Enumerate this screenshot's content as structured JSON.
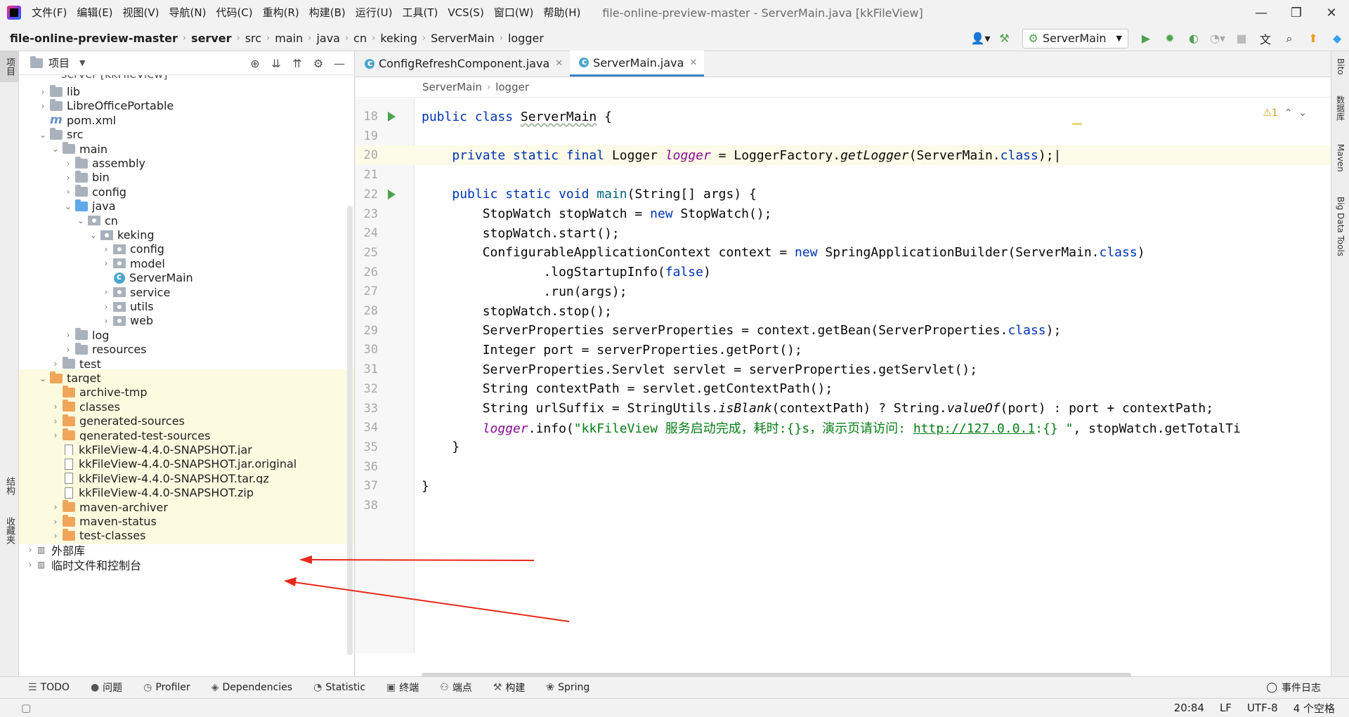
{
  "menubar": {
    "items": [
      "文件(F)",
      "编辑(E)",
      "视图(V)",
      "导航(N)",
      "代码(C)",
      "重构(R)",
      "构建(B)",
      "运行(U)",
      "工具(T)",
      "VCS(S)",
      "窗口(W)",
      "帮助(H)"
    ],
    "title": "file-online-preview-master - ServerMain.java [kkFileView]"
  },
  "breadcrumb": {
    "items": [
      "file-online-preview-master",
      "server",
      "src",
      "main",
      "java",
      "cn",
      "keking",
      "ServerMain",
      "logger"
    ]
  },
  "toolbar": {
    "run_config": "ServerMain"
  },
  "left_strip": {
    "project": "项目",
    "structure": "结构",
    "favorites": "收藏夹"
  },
  "project_panel": {
    "title": "项目",
    "truncated_top": "server [kkFileView]"
  },
  "tree": [
    {
      "label": "lib",
      "depth": 1,
      "chev": "›",
      "icon": "folder"
    },
    {
      "label": "LibreOfficePortable",
      "depth": 1,
      "chev": "›",
      "icon": "folder"
    },
    {
      "label": "pom.xml",
      "depth": 1,
      "chev": "",
      "icon": "maven"
    },
    {
      "label": "src",
      "depth": 1,
      "chev": "⌄",
      "icon": "folder"
    },
    {
      "label": "main",
      "depth": 2,
      "chev": "⌄",
      "icon": "folder"
    },
    {
      "label": "assembly",
      "depth": 3,
      "chev": "›",
      "icon": "folder"
    },
    {
      "label": "bin",
      "depth": 3,
      "chev": "›",
      "icon": "folder"
    },
    {
      "label": "config",
      "depth": 3,
      "chev": "›",
      "icon": "folder"
    },
    {
      "label": "java",
      "depth": 3,
      "chev": "⌄",
      "icon": "folder blue"
    },
    {
      "label": "cn",
      "depth": 4,
      "chev": "⌄",
      "icon": "pkg"
    },
    {
      "label": "keking",
      "depth": 5,
      "chev": "⌄",
      "icon": "pkg"
    },
    {
      "label": "config",
      "depth": 6,
      "chev": "›",
      "icon": "pkg"
    },
    {
      "label": "model",
      "depth": 6,
      "chev": "›",
      "icon": "pkg"
    },
    {
      "label": "ServerMain",
      "depth": 6,
      "chev": "",
      "icon": "cls"
    },
    {
      "label": "service",
      "depth": 6,
      "chev": "›",
      "icon": "pkg"
    },
    {
      "label": "utils",
      "depth": 6,
      "chev": "›",
      "icon": "pkg"
    },
    {
      "label": "web",
      "depth": 6,
      "chev": "›",
      "icon": "pkg"
    },
    {
      "label": "log",
      "depth": 3,
      "chev": "›",
      "icon": "folder"
    },
    {
      "label": "resources",
      "depth": 3,
      "chev": "›",
      "icon": "folder"
    },
    {
      "label": "test",
      "depth": 2,
      "chev": "›",
      "icon": "folder"
    },
    {
      "label": "target",
      "depth": 1,
      "chev": "⌄",
      "icon": "folder orange",
      "hl": true
    },
    {
      "label": "archive-tmp",
      "depth": 2,
      "chev": "",
      "icon": "folder orange",
      "hl": true
    },
    {
      "label": "classes",
      "depth": 2,
      "chev": "›",
      "icon": "folder orange",
      "hl": true
    },
    {
      "label": "generated-sources",
      "depth": 2,
      "chev": "›",
      "icon": "folder orange",
      "hl": true
    },
    {
      "label": "generated-test-sources",
      "depth": 2,
      "chev": "›",
      "icon": "folder orange",
      "hl": true
    },
    {
      "label": "kkFileView-4.4.0-SNAPSHOT.jar",
      "depth": 2,
      "chev": "",
      "icon": "file",
      "hl": true
    },
    {
      "label": "kkFileView-4.4.0-SNAPSHOT.jar.original",
      "depth": 2,
      "chev": "",
      "icon": "file",
      "hl": true
    },
    {
      "label": "kkFileView-4.4.0-SNAPSHOT.tar.gz",
      "depth": 2,
      "chev": "",
      "icon": "file",
      "hl": true
    },
    {
      "label": "kkFileView-4.4.0-SNAPSHOT.zip",
      "depth": 2,
      "chev": "",
      "icon": "file",
      "hl": true
    },
    {
      "label": "maven-archiver",
      "depth": 2,
      "chev": "›",
      "icon": "folder orange",
      "hl": true
    },
    {
      "label": "maven-status",
      "depth": 2,
      "chev": "›",
      "icon": "folder orange",
      "hl": true
    },
    {
      "label": "test-classes",
      "depth": 2,
      "chev": "›",
      "icon": "folder orange",
      "hl": true
    },
    {
      "label": "外部库",
      "depth": 0,
      "chev": "›",
      "icon": "none"
    },
    {
      "label": "临时文件和控制台",
      "depth": 0,
      "chev": "›",
      "icon": "none"
    }
  ],
  "tabs": [
    {
      "label": "ConfigRefreshComponent.java",
      "active": false
    },
    {
      "label": "ServerMain.java",
      "active": true
    }
  ],
  "editor_breadcrumb": [
    "ServerMain",
    "logger"
  ],
  "inspection": "⚠1",
  "code_lines": [
    {
      "n": "18",
      "run": true,
      "html": "<span class=\"kw\">public class</span> <span class=\"typo\">ServerMain</span> {"
    },
    {
      "n": "19",
      "html": ""
    },
    {
      "n": "20",
      "cur": true,
      "html": "    <span class=\"kw\">private static final</span> Logger <span class=\"fld\">logger</span> = LoggerFactory.<span class=\"it\">getLogger</span>(ServerMain.<span class=\"kw\">class</span>);|"
    },
    {
      "n": "21",
      "html": ""
    },
    {
      "n": "22",
      "run": true,
      "html": "    <span class=\"kw\">public static void</span> <span style=\"color:#00627a\">main</span>(String[] args) {"
    },
    {
      "n": "23",
      "html": "        StopWatch stopWatch = <span class=\"kw\">new</span> StopWatch();"
    },
    {
      "n": "24",
      "html": "        stopWatch.start();"
    },
    {
      "n": "25",
      "html": "        ConfigurableApplicationContext context = <span class=\"kw\">new</span> SpringApplicationBuilder(ServerMain.<span class=\"kw\">class</span>)"
    },
    {
      "n": "26",
      "html": "                .logStartupInfo(<span class=\"kw\">false</span>)"
    },
    {
      "n": "27",
      "html": "                .run(args);"
    },
    {
      "n": "28",
      "html": "        stopWatch.stop();"
    },
    {
      "n": "29",
      "html": "        ServerProperties serverProperties = context.getBean(ServerProperties.<span class=\"kw\">class</span>);"
    },
    {
      "n": "30",
      "html": "        Integer port = serverProperties.getPort();"
    },
    {
      "n": "31",
      "html": "        ServerProperties.Servlet servlet = serverProperties.getServlet();"
    },
    {
      "n": "32",
      "html": "        String contextPath = servlet.getContextPath();"
    },
    {
      "n": "33",
      "html": "        String urlSuffix = StringUtils.<span class=\"it\">isBlank</span>(contextPath) ? String.<span class=\"it\">valueOf</span>(port) : port + contextPath;"
    },
    {
      "n": "34",
      "html": "        <span class=\"fld\">logger</span>.info(<span class=\"str\">\"kkFileView 服务启动完成，耗时:{}s，演示页请访问: <span class=\"lnk\">http://127.0.0.1</span>:{} \"</span>, stopWatch.getTotalTi"
    },
    {
      "n": "35",
      "html": "    }"
    },
    {
      "n": "36",
      "html": ""
    },
    {
      "n": "37",
      "html": "}"
    },
    {
      "n": "38",
      "html": ""
    }
  ],
  "right_strip": [
    "Bito",
    "数据库",
    "Maven",
    "Big Data Tools"
  ],
  "bottom_tools": [
    {
      "icon": "☰",
      "label": "TODO"
    },
    {
      "icon": "●",
      "label": "问题"
    },
    {
      "icon": "◷",
      "label": "Profiler"
    },
    {
      "icon": "◈",
      "label": "Dependencies"
    },
    {
      "icon": "◔",
      "label": "Statistic"
    },
    {
      "icon": "▣",
      "label": "终端"
    },
    {
      "icon": "⚇",
      "label": "端点"
    },
    {
      "icon": "⚒",
      "label": "构建"
    },
    {
      "icon": "❀",
      "label": "Spring"
    }
  ],
  "event_log": "事件日志",
  "status": {
    "pos": "20:84",
    "lf": "LF",
    "enc": "UTF-8",
    "indent": "4 个空格"
  },
  "colors": {
    "accent": "#4083c9",
    "run_green": "#4ea24e",
    "target_highlight": "#fcfbe0",
    "annotation_arrow": "#e8281c"
  }
}
